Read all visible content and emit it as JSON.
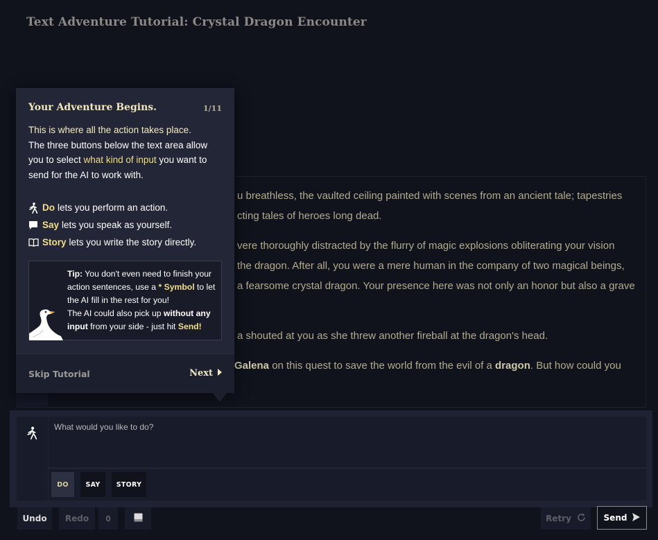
{
  "page": {
    "title": "Text Adventure Tutorial: Crystal Dragon Encounter"
  },
  "story": {
    "p1": {
      "line1": "u breathless, the vaulted ceiling painted with scenes from an ancient tale; tapestries",
      "line2": "cting tales of heroes long dead."
    },
    "p2": {
      "line1": "vere thoroughly distracted by the flurry of magic explosions obliterating your vision",
      "line2": "the dragon. After all, you were a mere human in the company of two magical beings,",
      "line3": "a fearsome crystal dragon. Your presence here was not only an honor but also a grave"
    },
    "p3": {
      "line1": "a shouted at you as she threw another fireball at the dragon's head."
    },
    "p4": {
      "name": "Galena",
      "mid": " on this quest to save the world from the evil of a ",
      "dragon": "dragon",
      "end": ". But how could you"
    }
  },
  "tutorial": {
    "heading": "Your Adventure Begins.",
    "count": "1/11",
    "intro_first": "This is where all the action takes place.",
    "intro_a": "The three buttons below the text area allow you to select ",
    "intro_hl": "what kind of input",
    "intro_b": " you want to send for the AI to work with.",
    "modes": [
      {
        "name": "Do",
        "desc": "lets you perform an action.",
        "icon": "walking-person-icon"
      },
      {
        "name": "Say",
        "desc": "lets you speak as yourself.",
        "icon": "speech-bubble-icon"
      },
      {
        "name": "Story",
        "desc": "lets you write the story directly.",
        "icon": "open-book-icon"
      }
    ],
    "tip": {
      "label": "Tip:",
      "t1": " You don't even need to finish your action sentences, use a ",
      "symbol": "* Symbol",
      "t2": " to let the AI fill in the rest for you!",
      "t3": "The AI could also pick up ",
      "no_input": "without any input",
      "t4": " from your side - just hit ",
      "send": "Send!"
    },
    "skip_label": "Skip Tutorial",
    "next_label": "Next"
  },
  "input": {
    "placeholder": "What would you like to do?",
    "modes": {
      "do": "DO",
      "say": "SAY",
      "story": "STORY"
    }
  },
  "controls": {
    "undo": "Undo",
    "redo": "Redo",
    "counter": "0",
    "retry": "Retry",
    "send": "Send"
  },
  "colors": {
    "background": "#10121c",
    "panel": "#222636",
    "accent": "#f2de8a"
  }
}
